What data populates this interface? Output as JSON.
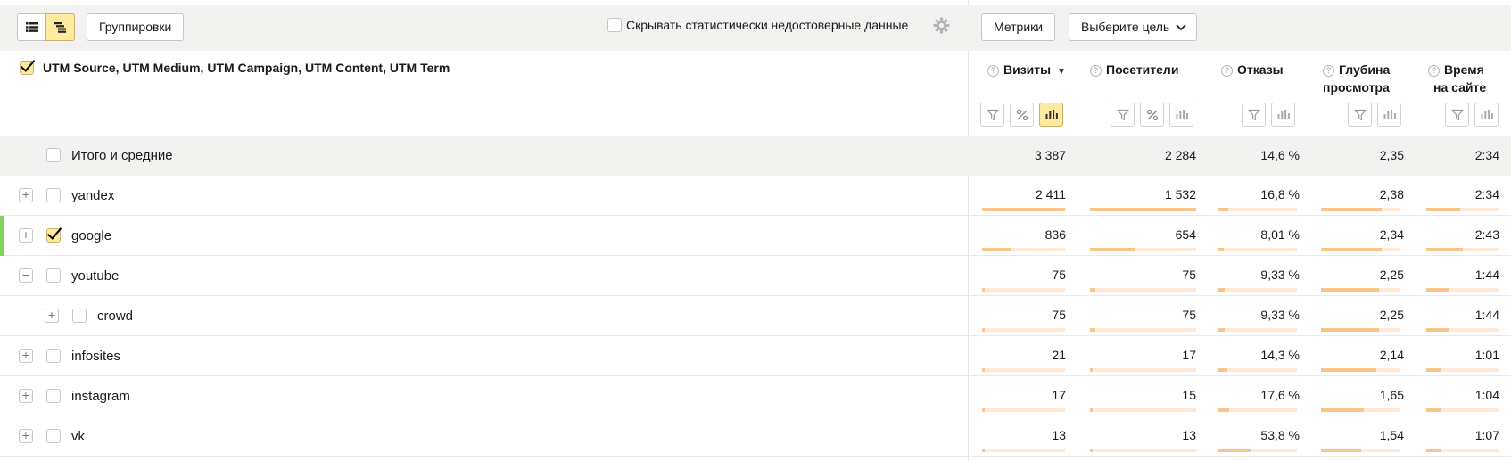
{
  "toolbar": {
    "groupings_label": "Группировки",
    "hide_stats_label": "Скрывать статистически недостоверные данные",
    "metrics_label": "Метрики",
    "goal_label": "Выберите цель"
  },
  "header": {
    "dimensions_label": "UTM Source, UTM Medium, UTM Campaign, UTM Content, UTM Term",
    "columns": {
      "visits": "Визиты",
      "visitors": "Посетители",
      "bounce": "Отказы",
      "depth_1": "Глубина",
      "depth_2": "просмотра",
      "time_1": "Время",
      "time_2": "на сайте"
    },
    "sort_indicator": "▼"
  },
  "total": {
    "label": "Итого и средние",
    "visits": "3 387",
    "visitors": "2 284",
    "bounce": "14,6 %",
    "depth": "2,35",
    "time": "2:34"
  },
  "rows": [
    {
      "label": "yandex",
      "expander": "+",
      "checked": false,
      "visits": "2 411",
      "visitors": "1 532",
      "bounce": "16,8 %",
      "depth": "2,38",
      "time": "2:34",
      "bars": {
        "visits": 1.0,
        "visitors": 1.0,
        "bounce": 0.13,
        "depth": 0.76,
        "time": 0.46
      }
    },
    {
      "label": "google",
      "expander": "+",
      "checked": true,
      "visits": "836",
      "visitors": "654",
      "bounce": "8,01 %",
      "depth": "2,34",
      "time": "2:43",
      "bars": {
        "visits": 0.35,
        "visitors": 0.43,
        "bounce": 0.07,
        "depth": 0.76,
        "time": 0.5
      }
    },
    {
      "label": "youtube",
      "expander": "−",
      "checked": false,
      "visits": "75",
      "visitors": "75",
      "bounce": "9,33 %",
      "depth": "2,25",
      "time": "1:44",
      "bars": {
        "visits": 0.03,
        "visitors": 0.05,
        "bounce": 0.08,
        "depth": 0.73,
        "time": 0.32
      }
    },
    {
      "label": "crowd",
      "expander": "+",
      "checked": false,
      "child": true,
      "visits": "75",
      "visitors": "75",
      "bounce": "9,33 %",
      "depth": "2,25",
      "time": "1:44",
      "bars": {
        "visits": 0.03,
        "visitors": 0.05,
        "bounce": 0.08,
        "depth": 0.73,
        "time": 0.32
      }
    },
    {
      "label": "infosites",
      "expander": "+",
      "checked": false,
      "visits": "21",
      "visitors": "17",
      "bounce": "14,3 %",
      "depth": "2,14",
      "time": "1:01",
      "bars": {
        "visits": 0.01,
        "visitors": 0.01,
        "bounce": 0.11,
        "depth": 0.7,
        "time": 0.19
      }
    },
    {
      "label": "instagram",
      "expander": "+",
      "checked": false,
      "visits": "17",
      "visitors": "15",
      "bounce": "17,6 %",
      "depth": "1,65",
      "time": "1:04",
      "bars": {
        "visits": 0.01,
        "visitors": 0.01,
        "bounce": 0.14,
        "depth": 0.54,
        "time": 0.2
      }
    },
    {
      "label": "vk",
      "expander": "+",
      "checked": false,
      "visits": "13",
      "visitors": "13",
      "bounce": "53,8 %",
      "depth": "1,54",
      "time": "1:07",
      "bars": {
        "visits": 0.01,
        "visitors": 0.01,
        "bounce": 0.42,
        "depth": 0.5,
        "time": 0.21
      }
    }
  ],
  "colors": {
    "accent_yellow": "#ffeba0",
    "bar_fill": "#f7c48b",
    "bar_track": "#fde9d6",
    "row_marker": "#7fd35a"
  },
  "icons": {
    "list_view": "list-icon",
    "tree_view": "tree-icon",
    "settings": "gear-icon",
    "goal_dropdown": "chevron-down-icon",
    "help": "question-icon",
    "filter": "filter-icon",
    "percent": "percent-icon",
    "chart": "bar-chart-icon"
  }
}
